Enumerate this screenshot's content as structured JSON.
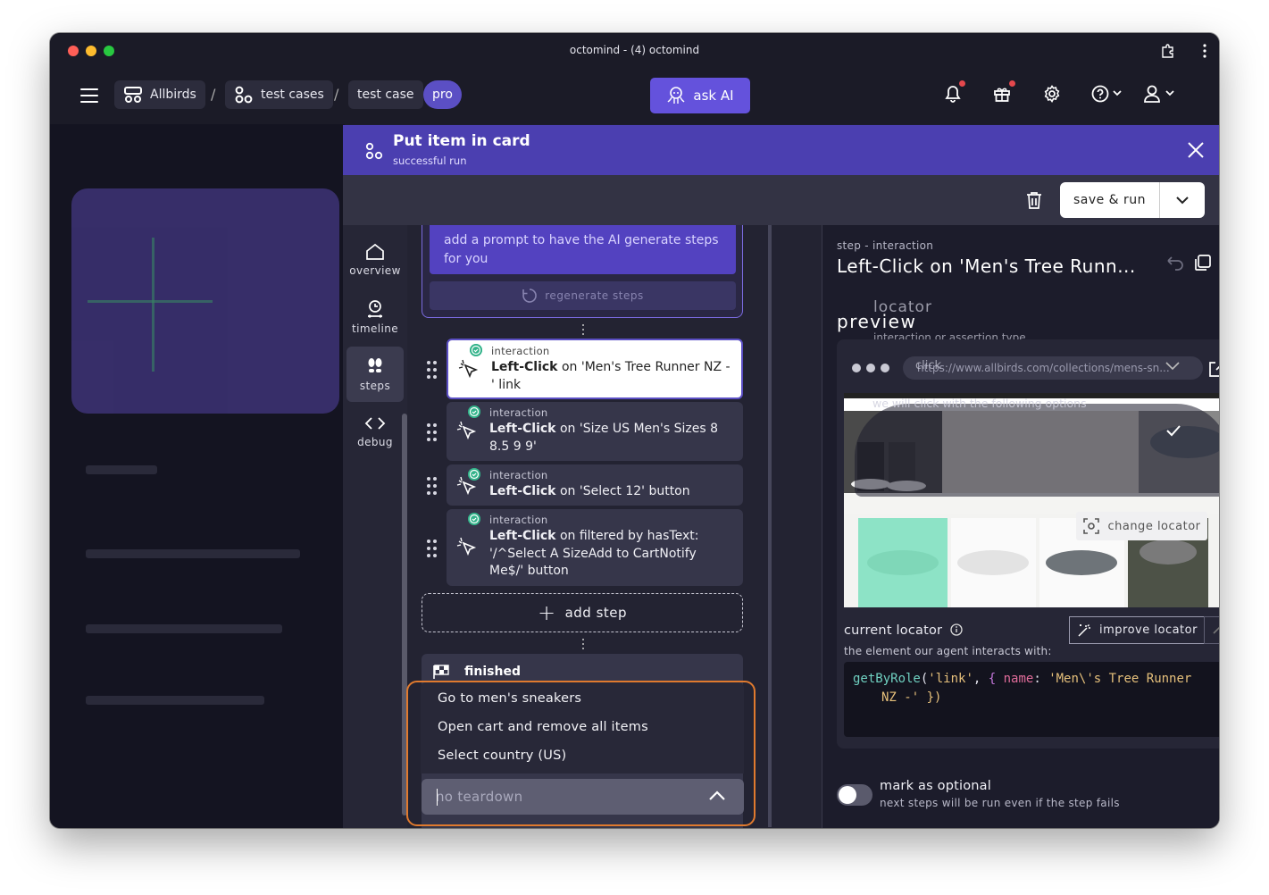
{
  "window": {
    "title": "octomind - (4) octomind"
  },
  "breadcrumbs": {
    "project": "Allbirds",
    "test_cases": "test cases",
    "test_case": "test case",
    "plan_badge": "pro",
    "separator": "/"
  },
  "header": {
    "ask_ai_label": "ask AI"
  },
  "drawer": {
    "title": "Put item in card",
    "subtitle": "successful run",
    "save_run_label": "save & run"
  },
  "sidebar": {
    "items": [
      {
        "label": "overview",
        "icon": "home-icon"
      },
      {
        "label": "timeline",
        "icon": "timeline-icon"
      },
      {
        "label": "steps",
        "icon": "footsteps-icon"
      },
      {
        "label": "debug",
        "icon": "code-icon"
      }
    ],
    "active": "steps"
  },
  "prompt": {
    "text": "add a prompt to have the AI generate steps for you",
    "regenerate_label": "regenerate steps"
  },
  "steps": [
    {
      "type": "interaction",
      "action": "Left-Click",
      "target": "on 'Men's Tree Runner NZ -' link",
      "selected": true
    },
    {
      "type": "interaction",
      "action": "Left-Click",
      "target": "on 'Size US Men's Sizes 8 8.5 9 9'"
    },
    {
      "type": "interaction",
      "action": "Left-Click",
      "target": "on 'Select 12' button"
    },
    {
      "type": "interaction",
      "action": "Left-Click",
      "target": "on filtered by hasText: '/^Select A SizeAdd to CartNotify Me$/' button"
    }
  ],
  "add_step_label": "add step",
  "finished_label": "finished",
  "teardown_dropdown": {
    "options": [
      "Go to men's sneakers",
      "Open cart and remove all items",
      "Select country (US)"
    ],
    "placeholder": "no teardown"
  },
  "detail": {
    "kind": "step - interaction",
    "title": "Left-Click on 'Men's Tree Runn...",
    "preview_label": "preview",
    "ghost_locator_label": "locator",
    "ghost_type_label": "interaction or assertion type",
    "ghost_type_value": "click",
    "ghost_options_label": "we will click with the following options",
    "url": "https://www.allbirds.com/collections/mens-sn...",
    "change_locator_label": "change locator",
    "current_locator_label": "current locator",
    "improve_locator_label": "improve locator",
    "element_interacts_label": "the element our agent interacts with:",
    "code": {
      "line1_fn": "getByRole",
      "line1_arg1": "'link'",
      "line1_key": "name",
      "line1_val": "'Men\\'s Tree Runner",
      "line2": "NZ -' })"
    },
    "optional_label": "mark as optional",
    "optional_sub": "next steps will be run even if the step fails",
    "optional_enabled": false
  },
  "colors": {
    "accent": "#5b4fc4",
    "header_purple": "#4b3fb0",
    "success": "#33b38a",
    "highlight_orange": "#e07a2e"
  }
}
